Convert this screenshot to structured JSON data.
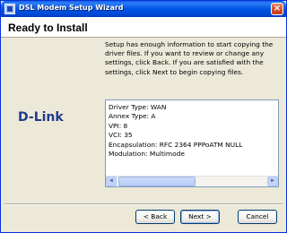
{
  "window": {
    "title": "DSL Modem Setup Wizard",
    "close_glyph": "×",
    "icon": "wizard-app-icon"
  },
  "header": {
    "title": "Ready to Install"
  },
  "logo": {
    "text": "D-Link"
  },
  "description": "Setup has enough information to start copying the driver files.  If you want to review or change any settings, click Back.  If you are satisfied with the settings, click Next to begin copying files.",
  "settings_list": {
    "lines": [
      "Driver Type: WAN",
      "Annex Type: A",
      "VPI: 8",
      "VCI: 35",
      "Encapsulation: RFC 2364 PPPoATM NULL",
      "Modulation: Multimode"
    ],
    "scroll_left_glyph": "◄",
    "scroll_right_glyph": "►"
  },
  "buttons": {
    "back": "< Back",
    "next": "Next >",
    "cancel": "Cancel"
  },
  "colors": {
    "titlebar": "#0055e5",
    "window_bg": "#ece9d8",
    "logo": "#1f3b8c",
    "close": "#d4502f"
  }
}
